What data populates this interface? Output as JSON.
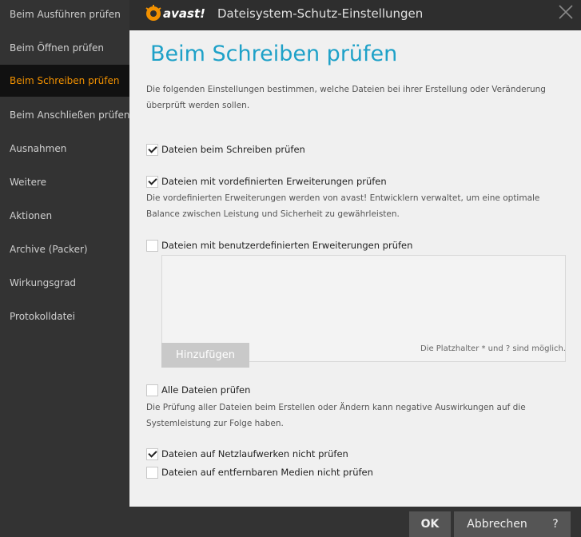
{
  "window": {
    "title": "Dateisystem-Schutz-Einstellungen",
    "brand": "avast!"
  },
  "colors": {
    "accent": "#1ea1c8",
    "active_nav": "#f29100",
    "sidebar_bg": "#333333",
    "content_bg": "#f0f0f0"
  },
  "sidebar": {
    "items": [
      {
        "label": "Beim Ausführen prüfen",
        "active": false
      },
      {
        "label": "Beim Öffnen prüfen",
        "active": false
      },
      {
        "label": "Beim Schreiben prüfen",
        "active": true
      },
      {
        "label": "Beim Anschließen prüfen",
        "active": false
      },
      {
        "label": "Ausnahmen",
        "active": false
      },
      {
        "label": "Weitere",
        "active": false
      },
      {
        "label": "Aktionen",
        "active": false
      },
      {
        "label": "Archive (Packer)",
        "active": false
      },
      {
        "label": "Wirkungsgrad",
        "active": false
      },
      {
        "label": "Protokolldatei",
        "active": false
      }
    ]
  },
  "main": {
    "title": "Beim Schreiben prüfen",
    "intro": "Die folgenden Einstellungen bestimmen, welche Dateien bei ihrer Erstellung oder Veränderung überprüft werden sollen.",
    "options": [
      {
        "label": "Dateien beim Schreiben prüfen",
        "checked": true
      },
      {
        "label": "Dateien mit vordefinierten Erweiterungen prüfen",
        "checked": true
      },
      {
        "label": "Dateien mit benutzerdefinierten Erweiterungen prüfen",
        "checked": false
      },
      {
        "label": "Alle Dateien prüfen",
        "checked": false
      },
      {
        "label": "Dateien auf Netzlaufwerken nicht prüfen",
        "checked": true
      },
      {
        "label": "Dateien auf entfernbaren Medien nicht prüfen",
        "checked": false
      }
    ],
    "predefined_desc": "Die vordefinierten Erweiterungen werden von avast! Entwicklern verwaltet, um eine optimale Balance zwischen Leistung und Sicherheit zu gewährleisten.",
    "all_files_desc": "Die Prüfung aller Dateien beim Erstellen oder Ändern kann negative Auswirkungen auf die Systemleistung zur Folge haben.",
    "add_button": "Hinzufügen",
    "wildcard_hint": "Die Platzhalter * und ? sind möglich."
  },
  "footer": {
    "ok": "OK",
    "cancel": "Abbrechen",
    "help": "?"
  }
}
